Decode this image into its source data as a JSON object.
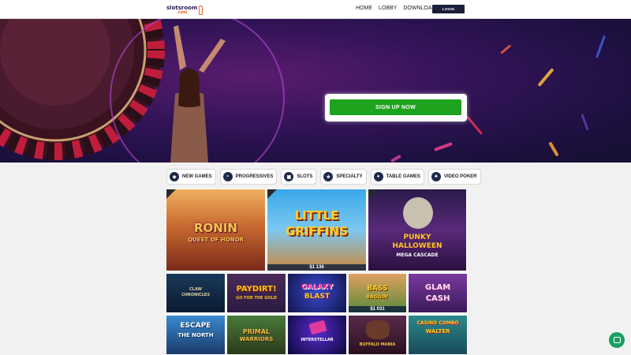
{
  "brand": {
    "name": "slotsroom",
    "tld": ".com"
  },
  "nav": {
    "items": [
      "HOME",
      "LOBBY",
      "DOWNLOAD"
    ],
    "login": "LOGIN"
  },
  "hero": {
    "signup": "SIGN UP NOW"
  },
  "categories": [
    {
      "label": "NEW GAMES",
      "icon": "diamond-icon"
    },
    {
      "label": "PROGRESSIVES",
      "icon": "coins-icon"
    },
    {
      "label": "SLOTS",
      "icon": "slot-machine-icon"
    },
    {
      "label": "SPECIALTY",
      "icon": "star-icon"
    },
    {
      "label": "TABLE GAMES",
      "icon": "cards-icon"
    },
    {
      "label": "VIDEO POKER",
      "icon": "poker-icon"
    }
  ],
  "featured": [
    {
      "line1": "RONIN",
      "line2": "QUEST OF HONOR",
      "jackpot": "",
      "is_new": true
    },
    {
      "line1": "LITTLE",
      "line2": "GRIFFINS",
      "jackpot": "$1 136",
      "is_new": true
    },
    {
      "line1": "PUNKY",
      "line2": "HALLOWEEN",
      "line3": "MEGA CASCADE",
      "jackpot": "",
      "is_new": true
    }
  ],
  "games_row1": [
    {
      "line1": "CLAW",
      "line2": "CHRONICLES",
      "jackpot": ""
    },
    {
      "line1": "PAYDIRT!",
      "line2": "GO FOR THE GOLD",
      "jackpot": ""
    },
    {
      "line1": "GALAXY",
      "line2": "BLAST",
      "jackpot": ""
    },
    {
      "line1": "BASS",
      "line2": "BAGGIN'",
      "jackpot": "$1 031"
    },
    {
      "line1": "GLAM",
      "line2": "CASH",
      "jackpot": ""
    }
  ],
  "games_row2": [
    {
      "line1": "ESCAPE",
      "line2": "THE NORTH"
    },
    {
      "line1": "PRIMAL",
      "line2": "WARRIORS"
    },
    {
      "line1": "",
      "line2": "INTERSTELLAR"
    },
    {
      "line1": "",
      "line2": "BUFFALO MANIA"
    },
    {
      "line1": "CASINO COMBO",
      "line2": "WALTER"
    }
  ],
  "colors": {
    "signup": "#1da31d",
    "login": "#1c1d3a",
    "chat": "#19a05f"
  }
}
